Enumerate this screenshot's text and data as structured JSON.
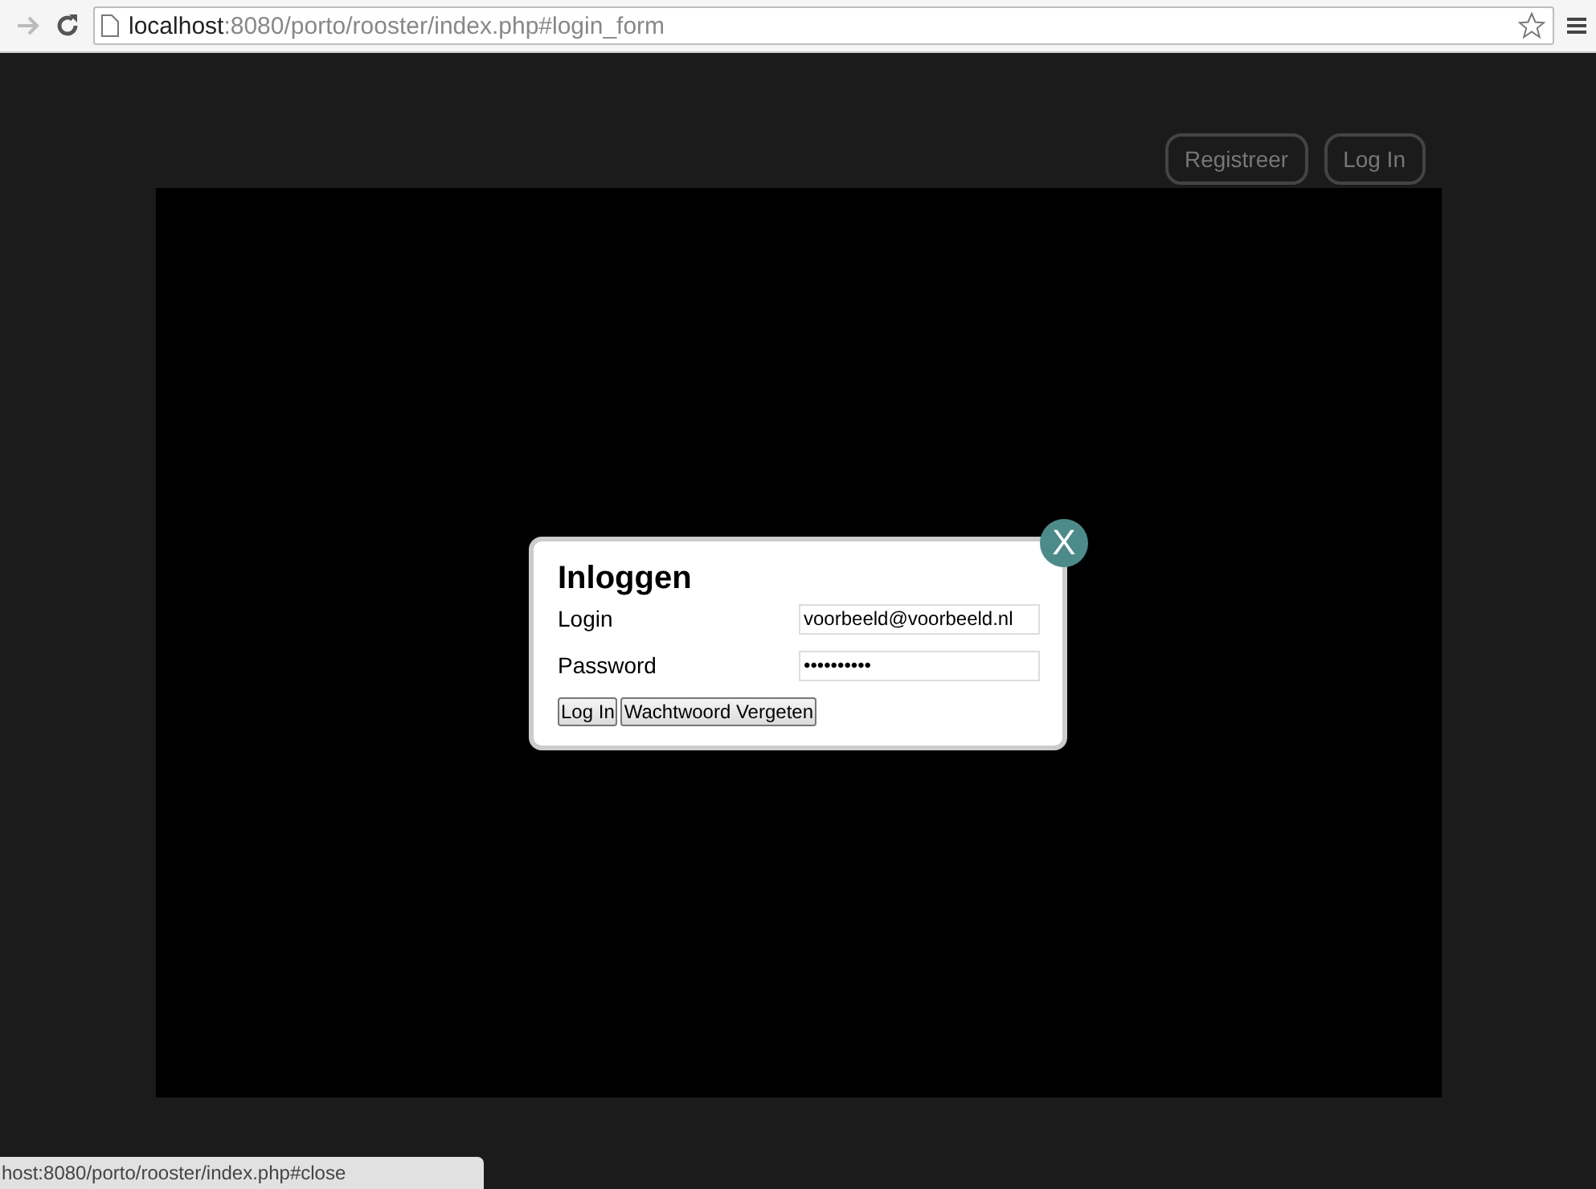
{
  "browser": {
    "url_host": "localhost",
    "url_path": ":8080/porto/rooster/index.php#login_form",
    "forward_disabled": true
  },
  "nav": [
    "Registreer",
    "Log In"
  ],
  "dialog": {
    "title": "Inloggen",
    "close": "X",
    "fields": [
      {
        "label": "Login",
        "value": "voorbeeld@voorbeeld.nl"
      },
      {
        "label": "Password",
        "value": "••••••••••"
      }
    ],
    "buttons": [
      "Log In",
      "Wachtwoord Vergeten"
    ]
  },
  "status_bar": "host:8080/porto/rooster/index.php#close"
}
